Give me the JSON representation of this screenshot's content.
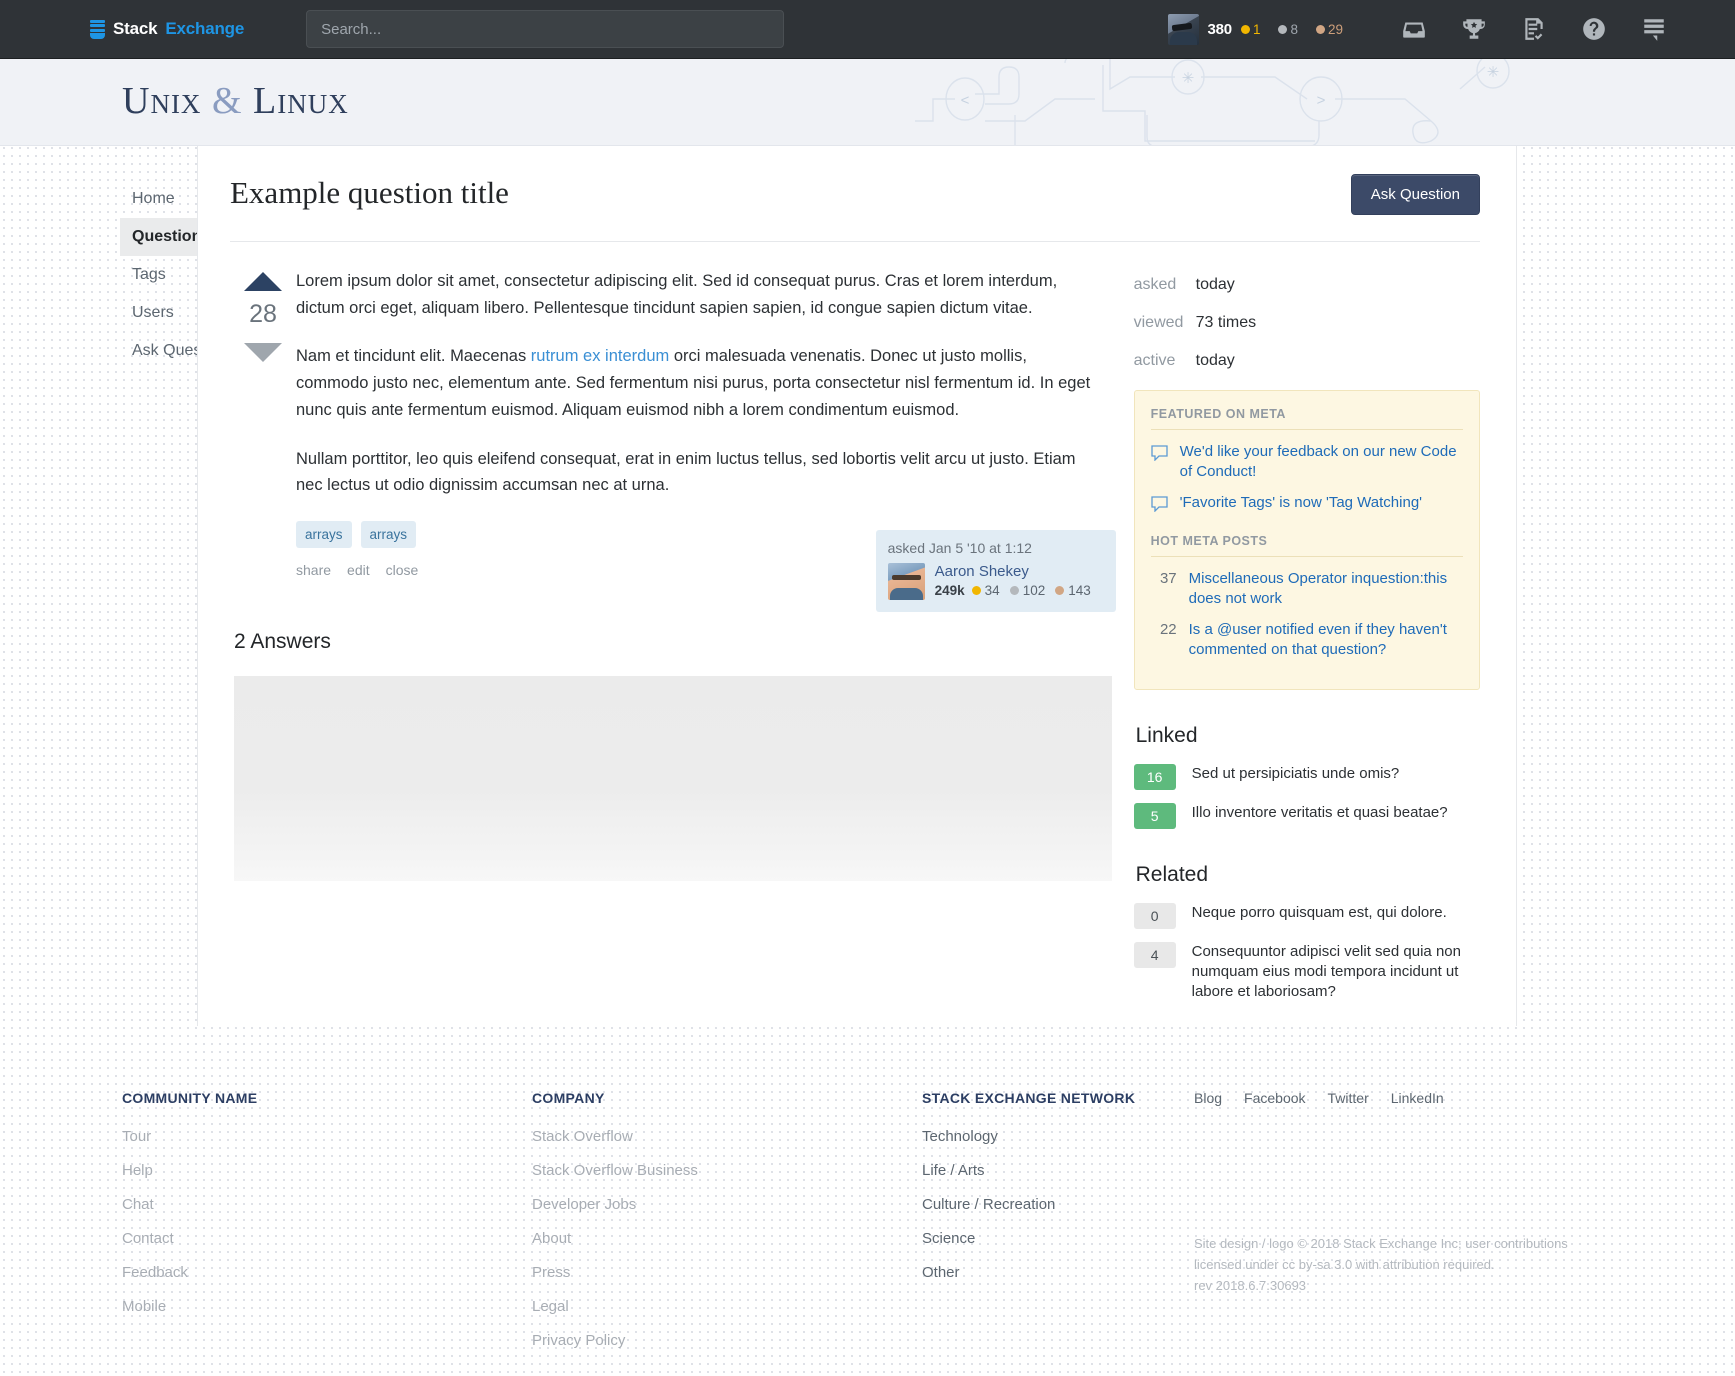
{
  "topbar": {
    "logo": {
      "icon": "stack-icon",
      "word1": "Stack",
      "word2": "Exchange"
    },
    "search": {
      "placeholder": "Search...",
      "value": "",
      "icon": "search-icon"
    },
    "user": {
      "avatar": "user-avatar",
      "reputation": "380",
      "badges": [
        {
          "type": "gold",
          "count": "1"
        },
        {
          "type": "silver",
          "count": "8"
        },
        {
          "type": "bronze",
          "count": "29"
        }
      ]
    },
    "icons": [
      "inbox-icon",
      "trophy-icon",
      "review-icon",
      "help-icon",
      "stack-menu-icon"
    ]
  },
  "siteheader": {
    "title_part1": "Unix",
    "title_amp": "&",
    "title_part2": "Linux",
    "decoration": "circuit-pattern"
  },
  "sidebar": {
    "items": [
      {
        "label": "Home",
        "active": false
      },
      {
        "label": "Questions",
        "active": true
      },
      {
        "label": "Tags",
        "active": false
      },
      {
        "label": "Users",
        "active": false
      },
      {
        "label": "Ask Question",
        "active": false
      }
    ]
  },
  "question": {
    "title": "Example question title",
    "ask_button": "Ask Question",
    "vote_score": "28",
    "upvote_icon": "arrow-up-icon",
    "downvote_icon": "arrow-down-icon",
    "paragraphs": [
      "Lorem ipsum dolor sit amet, consectetur adipiscing elit. Sed id consequat purus. Cras et lorem interdum, dictum orci eget, aliquam libero. Pellentesque tincidunt sapien sapien, id congue sapien dictum vitae.",
      "Nullam porttitor, leo quis eleifend consequat, erat in enim luctus tellus, sed lobortis velit arcu ut justo. Etiam nec lectus ut odio dignissim accumsan nec at urna."
    ],
    "paragraph2_pre": "Nam et tincidunt elit. Maecenas ",
    "paragraph2_link": "rutrum ex interdum",
    "paragraph2_post": " orci malesuada venenatis. Donec ut justo mollis, commodo justo nec, elementum ante. Sed fermentum nisi purus, porta consectetur nisl fermentum id. In eget nunc quis ante fermentum euismod. Aliquam euismod nibh a lorem condimentum euismod.",
    "tags": [
      "arrays",
      "arrays"
    ],
    "post_menu": [
      "share",
      "edit",
      "close"
    ],
    "signature": {
      "when": "asked Jan 5 '10 at 1:12",
      "avatar": "author-avatar",
      "name": "Aaron Shekey",
      "reputation": "249k",
      "badges": [
        {
          "type": "gold",
          "count": "34"
        },
        {
          "type": "silver",
          "count": "102"
        },
        {
          "type": "bronze",
          "count": "143"
        }
      ]
    }
  },
  "answers": {
    "heading": "2 Answers",
    "placeholder": "answer-content-placeholder"
  },
  "stats": [
    {
      "label": "asked",
      "value": "today"
    },
    {
      "label": "viewed",
      "value": "73 times"
    },
    {
      "label": "active",
      "value": "today"
    }
  ],
  "meta": {
    "featured_heading": "FEATURED ON META",
    "featured": [
      {
        "icon": "speech-bubble-icon",
        "text": "We'd like your feedback on our new Code of Conduct!"
      },
      {
        "icon": "speech-bubble-icon",
        "text": "'Favorite Tags' is now 'Tag Watching'"
      }
    ],
    "hot_heading": "HOT META POSTS",
    "hot": [
      {
        "score": "37",
        "text": "Miscellaneous Operator inquestion:this does not work"
      },
      {
        "score": "22",
        "text": "Is a @user notified even if they haven't commented on that question?"
      }
    ]
  },
  "linked": {
    "heading": "Linked",
    "items": [
      {
        "score": "16",
        "text": "Sed ut persipiciatis unde omis?"
      },
      {
        "score": "5",
        "text": "Illo inventore veritatis et quasi beatae?"
      }
    ]
  },
  "related": {
    "heading": "Related",
    "items": [
      {
        "score": "0",
        "text": "Neque porro quisquam est, qui dolore."
      },
      {
        "score": "4",
        "text": "Consequuntor adipisci velit sed quia non numquam eius modi tempora incidunt ut labore et laboriosam?"
      }
    ]
  },
  "footer": {
    "col1": {
      "heading": "COMMUNITY NAME",
      "links": [
        "Tour",
        "Help",
        "Chat",
        "Contact",
        "Feedback",
        "Mobile"
      ]
    },
    "col2": {
      "heading": "COMPANY",
      "links": [
        "Stack Overflow",
        "Stack Overflow Business",
        "Developer Jobs",
        "About",
        "Press",
        "Legal",
        "Privacy Policy"
      ]
    },
    "col3": {
      "heading": "STACK EXCHANGE NETWORK",
      "links": [
        "Technology",
        "Life / Arts",
        "Culture / Recreation",
        "Science",
        "Other"
      ]
    },
    "social": [
      "Blog",
      "Facebook",
      "Twitter",
      "LinkedIn"
    ],
    "legal_line1": "Site design / logo © 2018 Stack Exchange Inc; user contributions",
    "legal_line2": "licensed under cc by-sa 3.0 with attribution required.",
    "legal_line3": "rev 2018.6.7.30693"
  },
  "colors": {
    "topbar_bg": "#2f3337",
    "accent_blue": "#1e95e4",
    "site_header_bg": "#f0f2f6",
    "title_navy": "#2f3f5c",
    "ask_button": "#3c4a68",
    "tag_bg": "#e1ecf4",
    "tag_text": "#39739d",
    "meta_bg": "#fdf7e2",
    "link_blue": "#1e6bb8",
    "linked_green": "#5eba7d",
    "upvote_navy": "#2c4263"
  }
}
